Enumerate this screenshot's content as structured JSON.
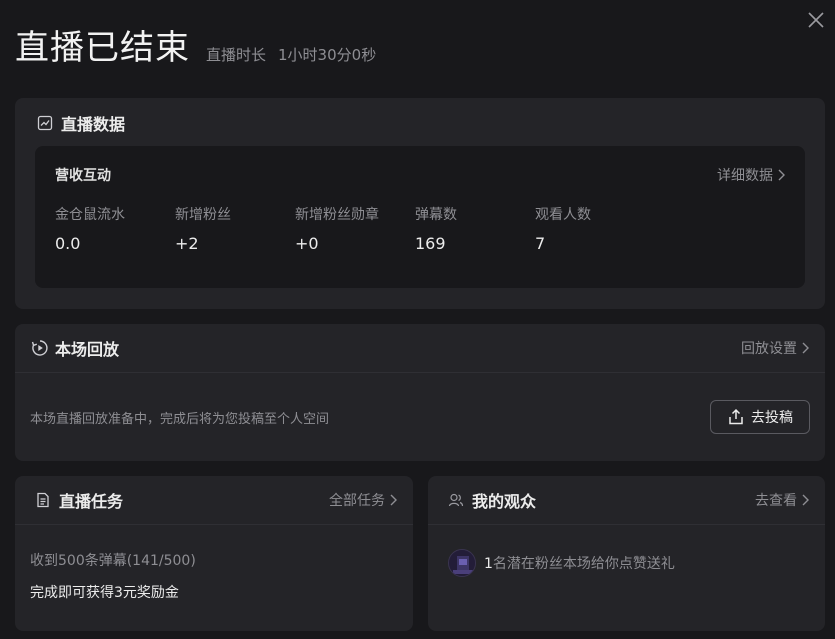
{
  "header": {
    "title": "直播已结束",
    "duration_label": "直播时长",
    "duration_value": "1小时30分0秒"
  },
  "stats_card": {
    "title": "直播数据",
    "section_title": "营收互动",
    "detail_link": "详细数据",
    "metrics": [
      {
        "label": "金仓鼠流水",
        "value": "0.0"
      },
      {
        "label": "新增粉丝",
        "value": "+2"
      },
      {
        "label": "新增粉丝勋章",
        "value": "+0"
      },
      {
        "label": "弹幕数",
        "value": "169"
      },
      {
        "label": "观看人数",
        "value": "7"
      }
    ]
  },
  "replay_card": {
    "title": "本场回放",
    "settings_link": "回放设置",
    "description": "本场直播回放准备中，完成后将为您投稿至个人空间",
    "upload_button": "去投稿"
  },
  "tasks_card": {
    "title": "直播任务",
    "all_link": "全部任务",
    "task_progress": "收到500条弹幕(141/500)",
    "task_reward": "完成即可获得3元奖励金"
  },
  "audience_card": {
    "title": "我的观众",
    "view_link": "去查看",
    "count": "1",
    "text": "名潜在粉丝本场给你点赞送礼"
  },
  "colors": {
    "background": "#18181b",
    "card": "#242428",
    "muted_text": "#8e8e93"
  }
}
